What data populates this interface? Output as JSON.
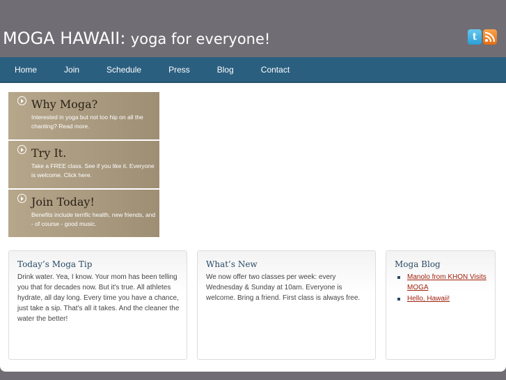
{
  "header": {
    "site_name": "MOGA HAWAII:",
    "tagline": "yoga for everyone!",
    "social": [
      {
        "icon": "twitter-icon",
        "glyph": "t"
      },
      {
        "icon": "rss-icon"
      }
    ]
  },
  "nav": {
    "items": [
      "Home",
      "Join",
      "Schedule",
      "Press",
      "Blog",
      "Contact"
    ]
  },
  "features": [
    {
      "title": "Why Moga?",
      "desc": "Interested in yoga but not too hip on all the chanting? Read more."
    },
    {
      "title": "Try It.",
      "desc": "Take a FREE class. See if you like it. Everyone is welcome. Click here."
    },
    {
      "title": "Join Today!",
      "desc": "Benefits include terrific health, new friends, and - of course - good music."
    }
  ],
  "boxes": {
    "tip": {
      "title": "Today’s Moga Tip",
      "body": "Drink water. Yea, I know. Your mom has been telling you that for decades now. But it's true. All athletes hydrate, all day long. Every time you have a chance, just take a sip. That's all it takes. And the cleaner the water the better!"
    },
    "news": {
      "title": "What’s New",
      "body": "We now offer two classes per week: every Wednesday & Sunday at 10am. Everyone is welcome. Bring a friend. First class is always free."
    },
    "blog": {
      "title": "Moga Blog",
      "links": [
        "Manolo from KHON Visits MOGA",
        "Hello, Hawaii!"
      ]
    }
  },
  "colors": {
    "header_bg": "#716d75",
    "nav_bg": "#2b5f80",
    "feature_bg": "#a99a80",
    "link": "#a0220d"
  }
}
